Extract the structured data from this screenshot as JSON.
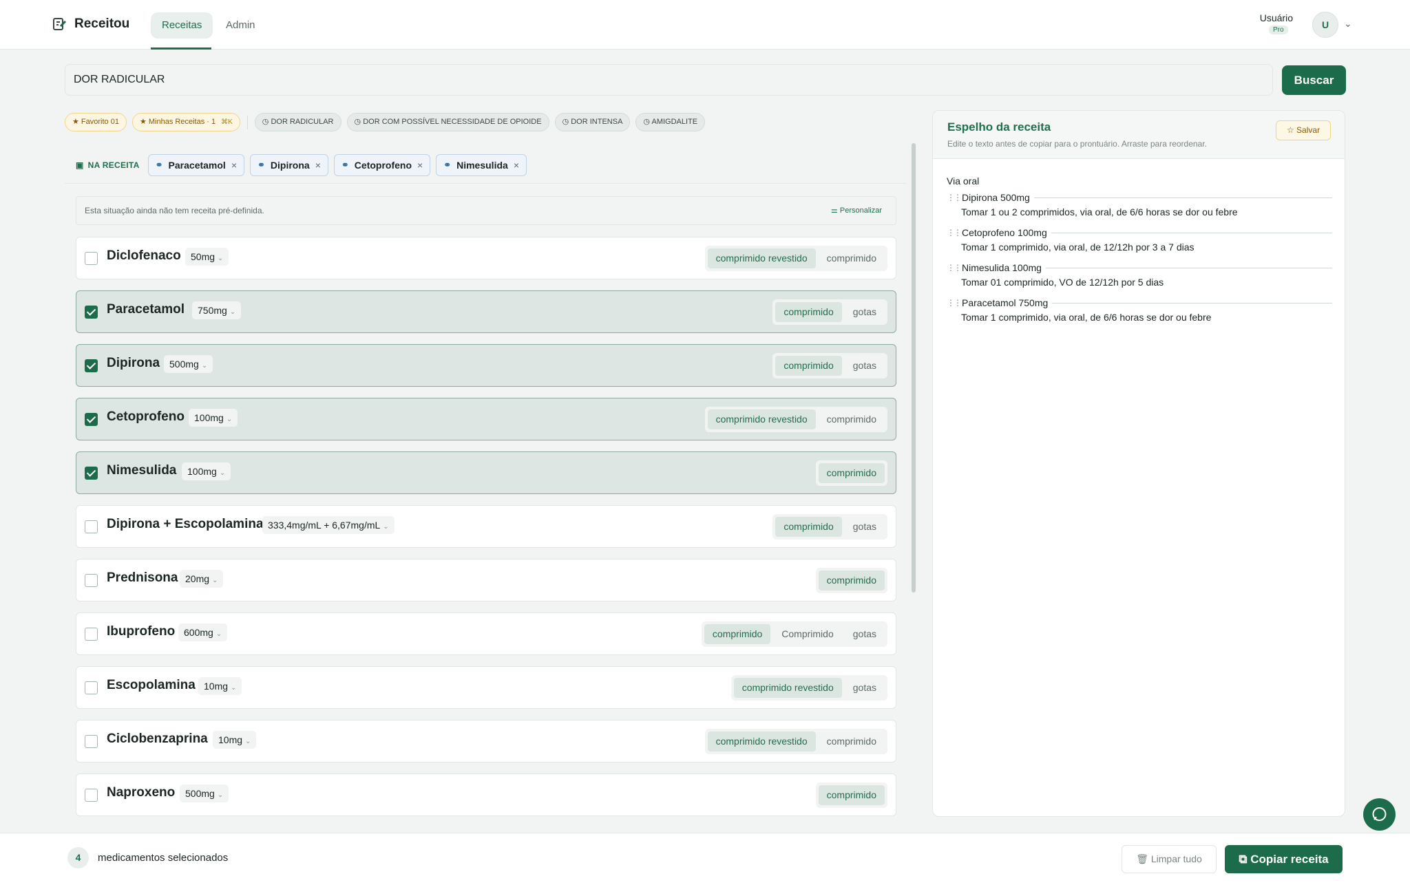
{
  "header": {
    "app_name": "Receitou",
    "tabs": [
      "Receitas",
      "Admin"
    ],
    "user_name": "Usuário",
    "user_plan": "Pro",
    "avatar_letter": "U"
  },
  "search": {
    "value": "DOR RADICULAR",
    "button_label": "Buscar"
  },
  "chips": {
    "favorite": "Favorito 01",
    "my_recipes": "Minhas Receitas · 1",
    "my_recipes_shortcut": "⌘K",
    "history": [
      "DOR RADICULAR",
      "DOR COM POSSÍVEL NECESSIDADE DE OPIOIDE",
      "DOR INTENSA",
      "AMIGDALITE"
    ]
  },
  "na_receita": {
    "label": "NA RECEITA",
    "items": [
      "Paracetamol",
      "Dipirona",
      "Cetoprofeno",
      "Nimesulida"
    ]
  },
  "notice": {
    "text": "Esta situação ainda não tem receita pré-definida.",
    "button": "Personalizar"
  },
  "medications": [
    {
      "name": "Diclofenaco",
      "dose": "50mg",
      "checked": false,
      "forms": [
        "comprimido revestido",
        "comprimido"
      ],
      "active": 0
    },
    {
      "name": "Paracetamol",
      "dose": "750mg",
      "checked": true,
      "forms": [
        "comprimido",
        "gotas"
      ],
      "active": 0
    },
    {
      "name": "Dipirona",
      "dose": "500mg",
      "checked": true,
      "forms": [
        "comprimido",
        "gotas"
      ],
      "active": 0
    },
    {
      "name": "Cetoprofeno",
      "dose": "100mg",
      "checked": true,
      "forms": [
        "comprimido revestido",
        "comprimido"
      ],
      "active": 0
    },
    {
      "name": "Nimesulida",
      "dose": "100mg",
      "checked": true,
      "forms": [
        "comprimido"
      ],
      "active": 0
    },
    {
      "name": "Dipirona + Escopolamina",
      "dose": "333,4mg/mL + 6,67mg/mL",
      "checked": false,
      "forms": [
        "comprimido",
        "gotas"
      ],
      "active": 0
    },
    {
      "name": "Prednisona",
      "dose": "20mg",
      "checked": false,
      "forms": [
        "comprimido"
      ],
      "active": 0
    },
    {
      "name": "Ibuprofeno",
      "dose": "600mg",
      "checked": false,
      "forms": [
        "comprimido",
        "Comprimido",
        "gotas"
      ],
      "active": 0
    },
    {
      "name": "Escopolamina",
      "dose": "10mg",
      "checked": false,
      "forms": [
        "comprimido revestido",
        "gotas"
      ],
      "active": 0
    },
    {
      "name": "Ciclobenzaprina",
      "dose": "10mg",
      "checked": false,
      "forms": [
        "comprimido revestido",
        "comprimido"
      ],
      "active": 0
    },
    {
      "name": "Naproxeno",
      "dose": "500mg",
      "checked": false,
      "forms": [
        "comprimido"
      ],
      "active": 0
    }
  ],
  "preview": {
    "title": "Espelho da receita",
    "subtitle": "Edite o texto antes de copiar para o prontuário. Arraste para reordenar.",
    "save_label": "Salvar",
    "route": "Via oral",
    "items": [
      {
        "title": "Dipirona 500mg",
        "instruction": "Tomar 1 ou 2 comprimidos, via oral, de 6/6 horas se dor ou febre"
      },
      {
        "title": "Cetoprofeno 100mg",
        "instruction": "Tomar 1 comprimido, via oral, de 12/12h por 3 a 7 dias"
      },
      {
        "title": "Nimesulida 100mg",
        "instruction": "Tomar 01 comprimido, VO de 12/12h por 5 dias"
      },
      {
        "title": "Paracetamol 750mg",
        "instruction": "Tomar 1 comprimido, via oral, de 6/6 horas se dor ou febre"
      }
    ]
  },
  "footer": {
    "count": "4",
    "count_label": "medicamentos selecionados",
    "clear_label": "Limpar tudo",
    "copy_label": "Copiar receita"
  },
  "colors": {
    "primary": "#1c6b4a",
    "selected_row": "#dde6e2",
    "background": "#f1f4f3"
  }
}
